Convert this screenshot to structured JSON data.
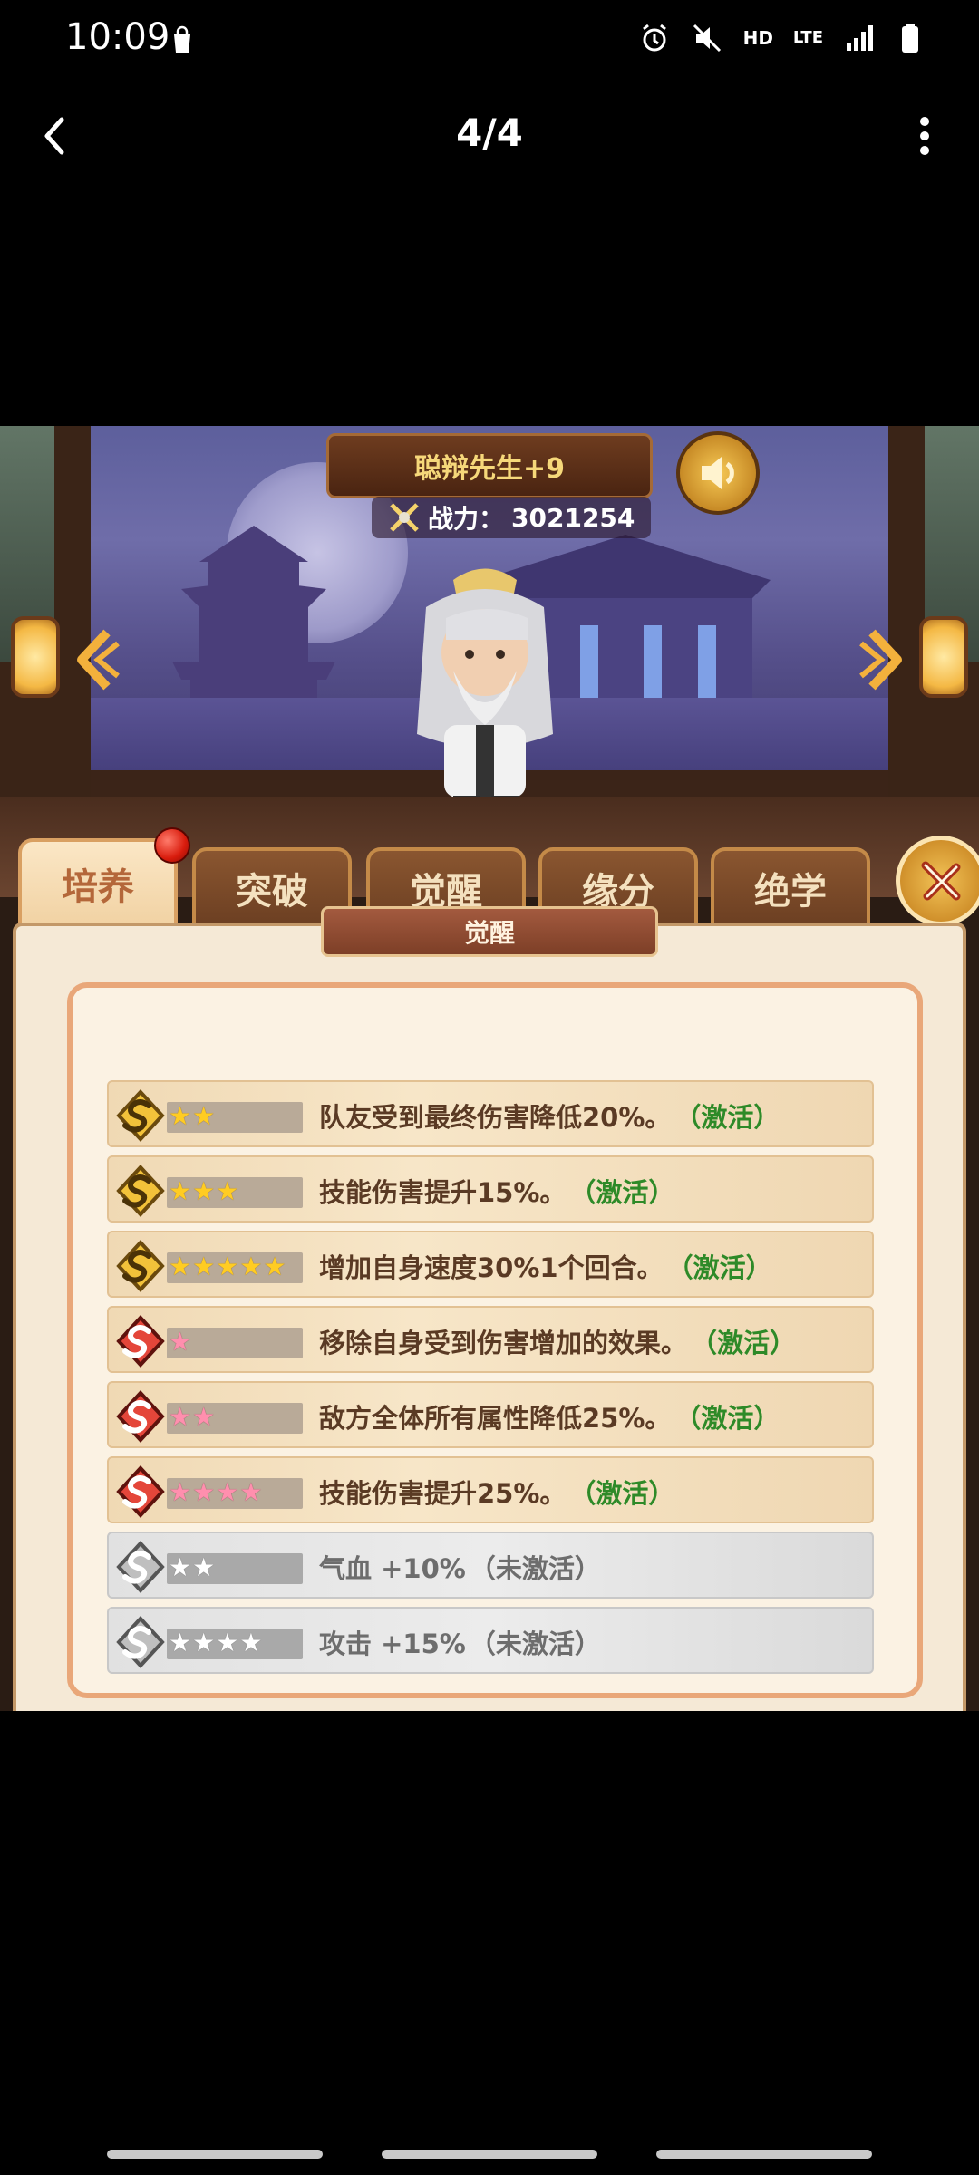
{
  "status_bar": {
    "time": "10:09",
    "hd": "HD",
    "lte": "LTE"
  },
  "app_bar": {
    "page_counter": "4/4"
  },
  "hero": {
    "name": "聪辩先生+9",
    "power_label": "战力：",
    "power_value": "3021254"
  },
  "tabs": [
    {
      "label": "培养",
      "active": true
    },
    {
      "label": "突破",
      "active": false
    },
    {
      "label": "觉醒",
      "active": false
    },
    {
      "label": "缘分",
      "active": false
    },
    {
      "label": "绝学",
      "active": false
    }
  ],
  "panel": {
    "section_title": "觉醒",
    "rows": [
      {
        "badge": "gold-s-icon",
        "stars": 2,
        "star_color": "gold",
        "text": "队友受到最终伤害降低20%。",
        "status": "（激活）",
        "active": true
      },
      {
        "badge": "gold-s-icon",
        "stars": 3,
        "star_color": "gold",
        "text": "技能伤害提升15%。",
        "status": "（激活）",
        "active": true
      },
      {
        "badge": "gold-s-icon",
        "stars": 5,
        "star_color": "gold",
        "text": "增加自身速度30%1个回合。",
        "status": "（激活）",
        "active": true
      },
      {
        "badge": "red-s-icon",
        "stars": 1,
        "star_color": "pink",
        "text": "移除自身受到伤害增加的效果。",
        "status": "（激活）",
        "active": true
      },
      {
        "badge": "red-s-icon",
        "stars": 2,
        "star_color": "pink",
        "text": "敌方全体所有属性降低25%。",
        "status": "（激活）",
        "active": true
      },
      {
        "badge": "red-s-icon",
        "stars": 4,
        "star_color": "pink",
        "text": "技能伤害提升25%。",
        "status": "（激活）",
        "active": true
      },
      {
        "badge": "silver-s-icon",
        "stars": 2,
        "star_color": "white",
        "text": "气血 +10%",
        "status": "（未激活）",
        "active": false
      },
      {
        "badge": "silver-s-icon",
        "stars": 4,
        "star_color": "white",
        "text": "攻击 +15%",
        "status": "（未激活）",
        "active": false
      }
    ]
  },
  "colors": {
    "active_status": "#2e8a28",
    "inactive_status": "#6d6d6d",
    "tab_active_text": "#b4673a"
  }
}
